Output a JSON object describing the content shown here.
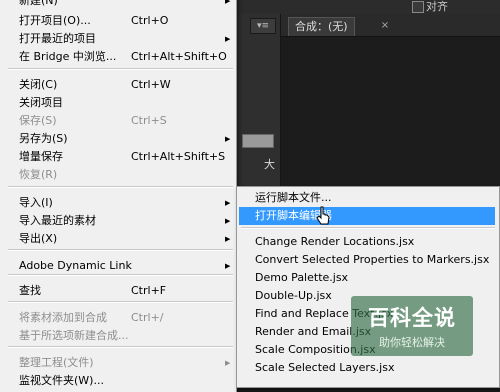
{
  "background_app": {
    "align_label": "对齐",
    "comp_tab_label": "合成：(无)",
    "comp_tab_close": "×",
    "panel_menu_glyph": "▾≡",
    "left_char": "大"
  },
  "main_menu": {
    "items": [
      {
        "label": "新建(N)",
        "shortcut": "",
        "arrow": "▶",
        "disabled": false
      },
      {
        "label": "打开项目(O)...",
        "shortcut": "Ctrl+O",
        "arrow": "",
        "disabled": false
      },
      {
        "label": "打开最近的项目",
        "shortcut": "",
        "arrow": "▶",
        "disabled": false
      },
      {
        "label": "在 Bridge 中浏览...",
        "shortcut": "Ctrl+Alt+Shift+O",
        "arrow": "",
        "disabled": false
      },
      {
        "label": "关闭(C)",
        "shortcut": "Ctrl+W",
        "arrow": "",
        "disabled": false
      },
      {
        "label": "关闭项目",
        "shortcut": "",
        "arrow": "",
        "disabled": false
      },
      {
        "label": "保存(S)",
        "shortcut": "Ctrl+S",
        "arrow": "",
        "disabled": true
      },
      {
        "label": "另存为(S)",
        "shortcut": "",
        "arrow": "▶",
        "disabled": false
      },
      {
        "label": "增量保存",
        "shortcut": "Ctrl+Alt+Shift+S",
        "arrow": "",
        "disabled": false
      },
      {
        "label": "恢复(R)",
        "shortcut": "",
        "arrow": "",
        "disabled": true
      },
      {
        "label": "导入(I)",
        "shortcut": "",
        "arrow": "▶",
        "disabled": false
      },
      {
        "label": "导入最近的素材",
        "shortcut": "",
        "arrow": "▶",
        "disabled": false
      },
      {
        "label": "导出(X)",
        "shortcut": "",
        "arrow": "▶",
        "disabled": false
      },
      {
        "label": "Adobe Dynamic Link",
        "shortcut": "",
        "arrow": "▶",
        "disabled": false
      },
      {
        "label": "查找",
        "shortcut": "Ctrl+F",
        "arrow": "",
        "disabled": false
      },
      {
        "label": "将素材添加到合成",
        "shortcut": "Ctrl+/",
        "arrow": "",
        "disabled": true
      },
      {
        "label": "基于所选项新建合成...",
        "shortcut": "",
        "arrow": "",
        "disabled": true
      },
      {
        "label": "整理工程(文件)",
        "shortcut": "",
        "arrow": "▶",
        "disabled": true
      },
      {
        "label": "监视文件夹(W)...",
        "shortcut": "",
        "arrow": "",
        "disabled": false
      }
    ]
  },
  "sub_menu": {
    "items": [
      {
        "label": "运行脚本文件...",
        "highlighted": false
      },
      {
        "label": "打开脚本编辑器",
        "highlighted": true
      },
      {
        "label": "Change Render Locations.jsx",
        "highlighted": false
      },
      {
        "label": "Convert Selected Properties to Markers.jsx",
        "highlighted": false
      },
      {
        "label": "Demo Palette.jsx",
        "highlighted": false
      },
      {
        "label": "Double-Up.jsx",
        "highlighted": false
      },
      {
        "label": "Find and Replace Text.jsx",
        "highlighted": false
      },
      {
        "label": "Render and Email.jsx",
        "highlighted": false
      },
      {
        "label": "Scale Composition.jsx",
        "highlighted": false
      },
      {
        "label": "Scale Selected Layers.jsx",
        "highlighted": false
      }
    ]
  },
  "watermark": {
    "title": "百科全说",
    "subtitle": "助你轻松解决"
  },
  "colors": {
    "menu_bg": "#f0f0f0",
    "highlight": "#3399ff",
    "disabled_text": "#8e8e8e"
  }
}
